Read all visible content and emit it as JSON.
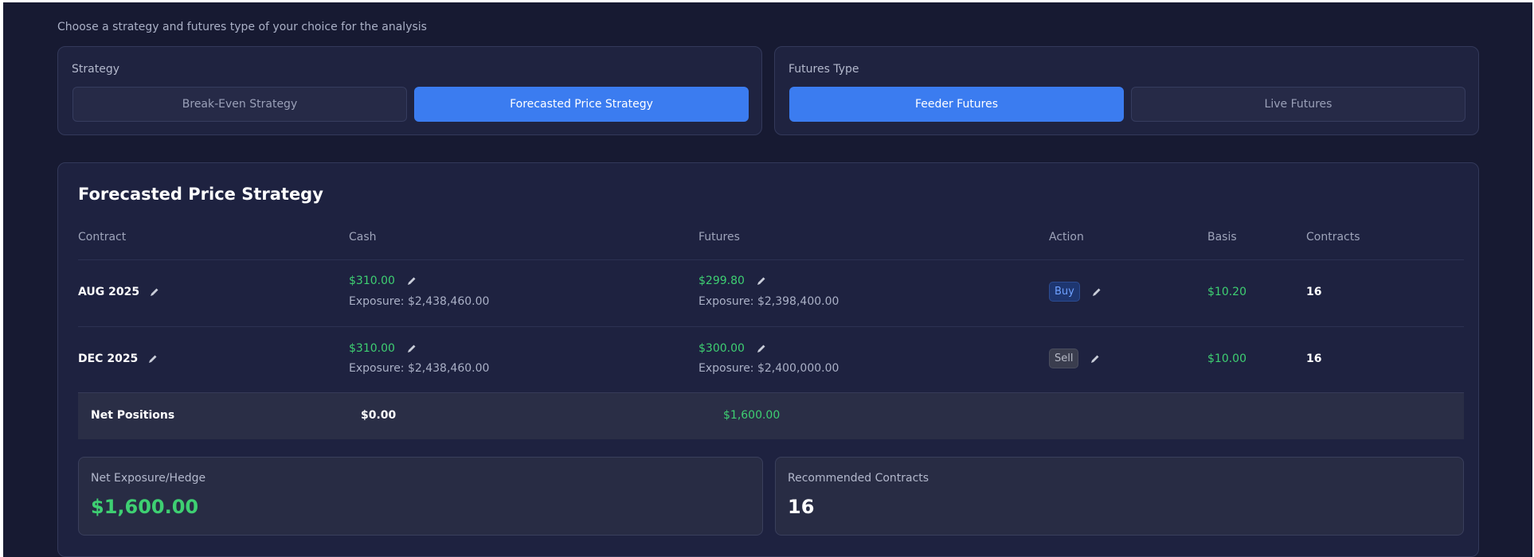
{
  "intro_text": "Choose a strategy and futures type of your choice for the analysis",
  "strategy": {
    "label": "Strategy",
    "options": [
      "Break-Even Strategy",
      "Forecasted Price Strategy"
    ],
    "selected": "Forecasted Price Strategy"
  },
  "futures_type": {
    "label": "Futures Type",
    "options": [
      "Feeder Futures",
      "Live Futures"
    ],
    "selected": "Feeder Futures"
  },
  "table": {
    "title": "Forecasted Price Strategy",
    "headers": [
      "Contract",
      "Cash",
      "Futures",
      "Action",
      "Basis",
      "Contracts"
    ],
    "rows": [
      {
        "contract": "AUG 2025",
        "cash": "$310.00",
        "cash_exposure": "Exposure: $2,438,460.00",
        "futures": "$299.80",
        "futures_exposure": "Exposure: $2,398,400.00",
        "action": "Buy",
        "basis": "$10.20",
        "contracts": "16"
      },
      {
        "contract": "DEC 2025",
        "cash": "$310.00",
        "cash_exposure": "Exposure: $2,438,460.00",
        "futures": "$300.00",
        "futures_exposure": "Exposure: $2,400,000.00",
        "action": "Sell",
        "basis": "$10.00",
        "contracts": "16"
      }
    ],
    "net": {
      "label": "Net Positions",
      "cash": "$0.00",
      "futures": "$1,600.00"
    }
  },
  "summary": {
    "net_exposure_label": "Net Exposure/Hedge",
    "net_exposure_value": "$1,600.00",
    "recommended_label": "Recommended Contracts",
    "recommended_value": "16"
  },
  "colors": {
    "background": "#171a32",
    "accent": "#3b7cf0",
    "positive": "#3ecf72",
    "buy_badge": "#6ea0ff",
    "sell_badge": "#b6b9c6"
  },
  "icons": {
    "edit": "pencil-icon"
  }
}
